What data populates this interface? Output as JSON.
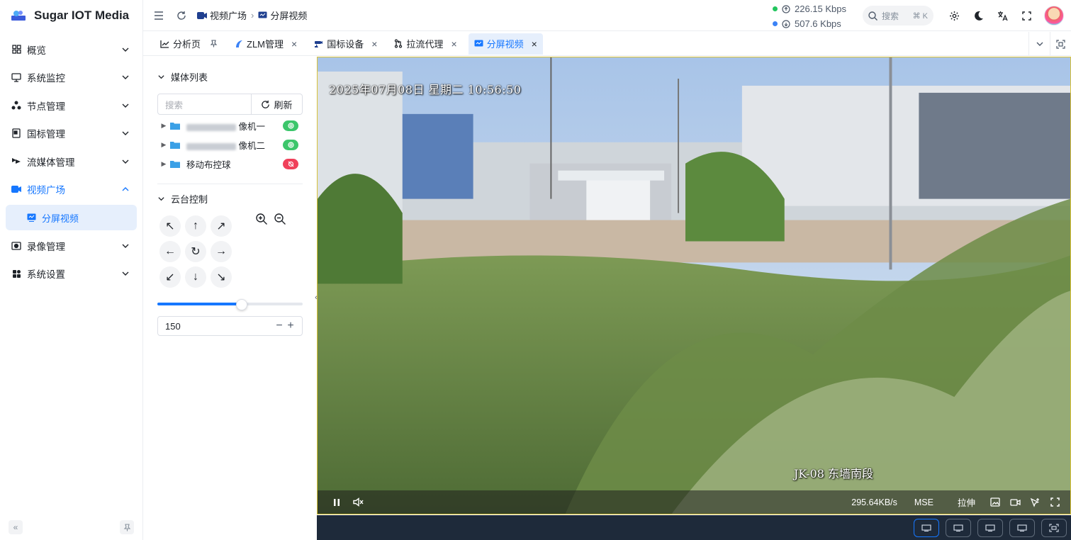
{
  "app": {
    "name": "Sugar IOT Media"
  },
  "sidebar": {
    "items": [
      {
        "label": "概览",
        "icon": "dashboard-icon"
      },
      {
        "label": "系统监控",
        "icon": "monitor-icon"
      },
      {
        "label": "节点管理",
        "icon": "nodes-icon"
      },
      {
        "label": "国标管理",
        "icon": "device-icon"
      },
      {
        "label": "流媒体管理",
        "icon": "stream-icon"
      },
      {
        "label": "视频广场",
        "icon": "video-icon"
      },
      {
        "label": "录像管理",
        "icon": "record-icon"
      },
      {
        "label": "系统设置",
        "icon": "settings-icon"
      }
    ],
    "sub_item": {
      "label": "分屏视频",
      "icon": "split-screen-icon"
    }
  },
  "header": {
    "breadcrumbs": [
      "视频广场",
      "分屏视频"
    ],
    "upload_speed": "226.15 Kbps",
    "download_speed": "507.6 Kbps",
    "search_placeholder": "搜索",
    "search_shortcut": "⌘ K",
    "colors": {
      "accent": "#1677ff",
      "green_dot": "#22c55e",
      "blue_dot": "#3b82f6"
    }
  },
  "tabs": [
    {
      "label": "分析页",
      "pinned": true
    },
    {
      "label": "ZLM管理"
    },
    {
      "label": "国标设备"
    },
    {
      "label": "拉流代理"
    },
    {
      "label": "分屏视频",
      "active": true
    }
  ],
  "panel": {
    "media_title": "媒体列表",
    "search_placeholder": "搜索",
    "refresh_label": "刷新",
    "tree": [
      {
        "label": "像机一",
        "status": "online"
      },
      {
        "label": "像机二",
        "status": "online"
      },
      {
        "label": "移动布控球",
        "status": "offline"
      }
    ],
    "ptz_title": "云台控制",
    "speed_value": "150",
    "speed_fraction": 0.58
  },
  "video": {
    "osd_time": "2025年07月08日 星期二 10:56:50",
    "osd_camera": "JK-08 东墙南段",
    "bitrate": "295.64KB/s",
    "mode": "MSE",
    "stretch_label": "拉伸"
  }
}
